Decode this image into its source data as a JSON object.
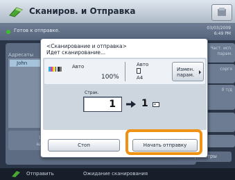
{
  "app": {
    "title": "Сканиров. и Отправка"
  },
  "status": {
    "text": "Готов к отправке.",
    "date": "03/03/2009",
    "time": "6:49 PM"
  },
  "background": {
    "left_tab": "Адресаты",
    "list_item": "John",
    "left_button_lines": [
      "Уд",
      "адр"
    ],
    "right_buttons": [
      "Част. исп. парам.",
      "сорго",
      "0 т/д",
      "",
      ""
    ],
    "params_button": "Параметры"
  },
  "dialog": {
    "header_line1": "<Сканирование и отправка>",
    "header_line2": "Идет сканирование...",
    "color_mode": "Авто",
    "density": "100%",
    "size_label": "Авто",
    "size_value": "A4",
    "change_button_line1": "Измен.",
    "change_button_line2": "парам.",
    "pages_label": "Страк.",
    "pages_scanned": "1",
    "pages_sent": "1",
    "stop_button": "Стоп",
    "send_button": "Начать отправку"
  },
  "bottom": {
    "label": "Отправить",
    "status": "Ожидание сканирования"
  },
  "colors": {
    "highlight": "#f09314",
    "status_dot": "#39c02a"
  }
}
